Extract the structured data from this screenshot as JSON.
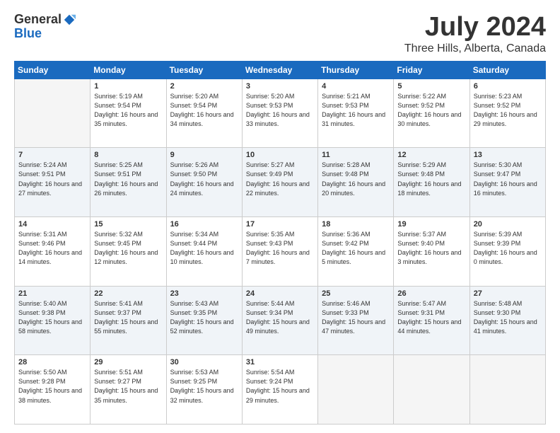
{
  "logo": {
    "general": "General",
    "blue": "Blue"
  },
  "header": {
    "month": "July 2024",
    "location": "Three Hills, Alberta, Canada"
  },
  "days_of_week": [
    "Sunday",
    "Monday",
    "Tuesday",
    "Wednesday",
    "Thursday",
    "Friday",
    "Saturday"
  ],
  "weeks": [
    [
      {
        "num": "",
        "empty": true
      },
      {
        "num": "1",
        "sunrise": "Sunrise: 5:19 AM",
        "sunset": "Sunset: 9:54 PM",
        "daylight": "Daylight: 16 hours and 35 minutes."
      },
      {
        "num": "2",
        "sunrise": "Sunrise: 5:20 AM",
        "sunset": "Sunset: 9:54 PM",
        "daylight": "Daylight: 16 hours and 34 minutes."
      },
      {
        "num": "3",
        "sunrise": "Sunrise: 5:20 AM",
        "sunset": "Sunset: 9:53 PM",
        "daylight": "Daylight: 16 hours and 33 minutes."
      },
      {
        "num": "4",
        "sunrise": "Sunrise: 5:21 AM",
        "sunset": "Sunset: 9:53 PM",
        "daylight": "Daylight: 16 hours and 31 minutes."
      },
      {
        "num": "5",
        "sunrise": "Sunrise: 5:22 AM",
        "sunset": "Sunset: 9:52 PM",
        "daylight": "Daylight: 16 hours and 30 minutes."
      },
      {
        "num": "6",
        "sunrise": "Sunrise: 5:23 AM",
        "sunset": "Sunset: 9:52 PM",
        "daylight": "Daylight: 16 hours and 29 minutes."
      }
    ],
    [
      {
        "num": "7",
        "sunrise": "Sunrise: 5:24 AM",
        "sunset": "Sunset: 9:51 PM",
        "daylight": "Daylight: 16 hours and 27 minutes."
      },
      {
        "num": "8",
        "sunrise": "Sunrise: 5:25 AM",
        "sunset": "Sunset: 9:51 PM",
        "daylight": "Daylight: 16 hours and 26 minutes."
      },
      {
        "num": "9",
        "sunrise": "Sunrise: 5:26 AM",
        "sunset": "Sunset: 9:50 PM",
        "daylight": "Daylight: 16 hours and 24 minutes."
      },
      {
        "num": "10",
        "sunrise": "Sunrise: 5:27 AM",
        "sunset": "Sunset: 9:49 PM",
        "daylight": "Daylight: 16 hours and 22 minutes."
      },
      {
        "num": "11",
        "sunrise": "Sunrise: 5:28 AM",
        "sunset": "Sunset: 9:48 PM",
        "daylight": "Daylight: 16 hours and 20 minutes."
      },
      {
        "num": "12",
        "sunrise": "Sunrise: 5:29 AM",
        "sunset": "Sunset: 9:48 PM",
        "daylight": "Daylight: 16 hours and 18 minutes."
      },
      {
        "num": "13",
        "sunrise": "Sunrise: 5:30 AM",
        "sunset": "Sunset: 9:47 PM",
        "daylight": "Daylight: 16 hours and 16 minutes."
      }
    ],
    [
      {
        "num": "14",
        "sunrise": "Sunrise: 5:31 AM",
        "sunset": "Sunset: 9:46 PM",
        "daylight": "Daylight: 16 hours and 14 minutes."
      },
      {
        "num": "15",
        "sunrise": "Sunrise: 5:32 AM",
        "sunset": "Sunset: 9:45 PM",
        "daylight": "Daylight: 16 hours and 12 minutes."
      },
      {
        "num": "16",
        "sunrise": "Sunrise: 5:34 AM",
        "sunset": "Sunset: 9:44 PM",
        "daylight": "Daylight: 16 hours and 10 minutes."
      },
      {
        "num": "17",
        "sunrise": "Sunrise: 5:35 AM",
        "sunset": "Sunset: 9:43 PM",
        "daylight": "Daylight: 16 hours and 7 minutes."
      },
      {
        "num": "18",
        "sunrise": "Sunrise: 5:36 AM",
        "sunset": "Sunset: 9:42 PM",
        "daylight": "Daylight: 16 hours and 5 minutes."
      },
      {
        "num": "19",
        "sunrise": "Sunrise: 5:37 AM",
        "sunset": "Sunset: 9:40 PM",
        "daylight": "Daylight: 16 hours and 3 minutes."
      },
      {
        "num": "20",
        "sunrise": "Sunrise: 5:39 AM",
        "sunset": "Sunset: 9:39 PM",
        "daylight": "Daylight: 16 hours and 0 minutes."
      }
    ],
    [
      {
        "num": "21",
        "sunrise": "Sunrise: 5:40 AM",
        "sunset": "Sunset: 9:38 PM",
        "daylight": "Daylight: 15 hours and 58 minutes."
      },
      {
        "num": "22",
        "sunrise": "Sunrise: 5:41 AM",
        "sunset": "Sunset: 9:37 PM",
        "daylight": "Daylight: 15 hours and 55 minutes."
      },
      {
        "num": "23",
        "sunrise": "Sunrise: 5:43 AM",
        "sunset": "Sunset: 9:35 PM",
        "daylight": "Daylight: 15 hours and 52 minutes."
      },
      {
        "num": "24",
        "sunrise": "Sunrise: 5:44 AM",
        "sunset": "Sunset: 9:34 PM",
        "daylight": "Daylight: 15 hours and 49 minutes."
      },
      {
        "num": "25",
        "sunrise": "Sunrise: 5:46 AM",
        "sunset": "Sunset: 9:33 PM",
        "daylight": "Daylight: 15 hours and 47 minutes."
      },
      {
        "num": "26",
        "sunrise": "Sunrise: 5:47 AM",
        "sunset": "Sunset: 9:31 PM",
        "daylight": "Daylight: 15 hours and 44 minutes."
      },
      {
        "num": "27",
        "sunrise": "Sunrise: 5:48 AM",
        "sunset": "Sunset: 9:30 PM",
        "daylight": "Daylight: 15 hours and 41 minutes."
      }
    ],
    [
      {
        "num": "28",
        "sunrise": "Sunrise: 5:50 AM",
        "sunset": "Sunset: 9:28 PM",
        "daylight": "Daylight: 15 hours and 38 minutes."
      },
      {
        "num": "29",
        "sunrise": "Sunrise: 5:51 AM",
        "sunset": "Sunset: 9:27 PM",
        "daylight": "Daylight: 15 hours and 35 minutes."
      },
      {
        "num": "30",
        "sunrise": "Sunrise: 5:53 AM",
        "sunset": "Sunset: 9:25 PM",
        "daylight": "Daylight: 15 hours and 32 minutes."
      },
      {
        "num": "31",
        "sunrise": "Sunrise: 5:54 AM",
        "sunset": "Sunset: 9:24 PM",
        "daylight": "Daylight: 15 hours and 29 minutes."
      },
      {
        "num": "",
        "empty": true
      },
      {
        "num": "",
        "empty": true
      },
      {
        "num": "",
        "empty": true
      }
    ]
  ]
}
